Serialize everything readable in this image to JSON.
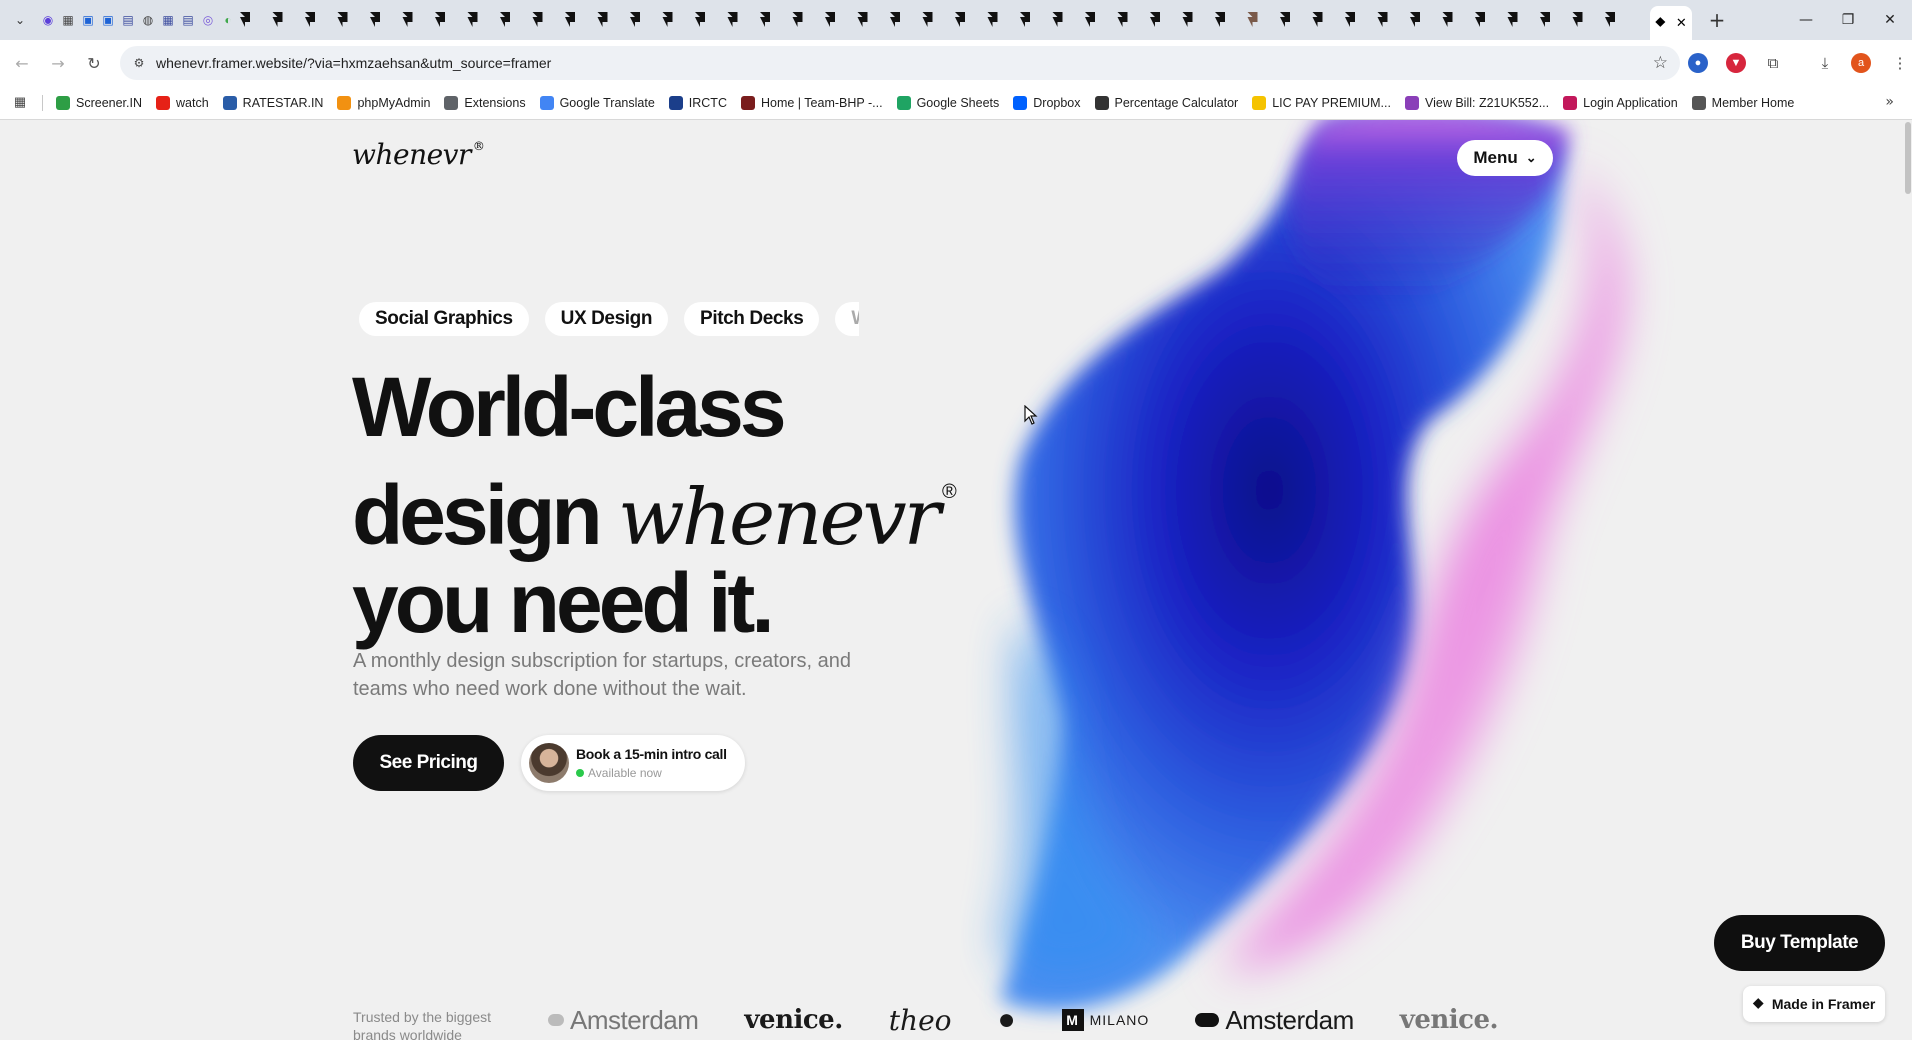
{
  "browser": {
    "tab": {
      "favicon": "framer-icon",
      "close_label": "✕"
    },
    "new_tab_label": "+",
    "window": {
      "minimize": "—",
      "restore": "❐",
      "close": "✕"
    },
    "nav": {
      "back": "←",
      "forward": "→",
      "reload": "↻"
    },
    "url": "whenevr.framer.website/?via=hxmzaehsan&utm_source=framer",
    "profile_initial": "a",
    "bookmarks": [
      {
        "label": "Screener.IN",
        "icon_color": "#2e9e45"
      },
      {
        "label": "watch",
        "icon_color": "#e62117"
      },
      {
        "label": "RATESTAR.IN",
        "icon_color": "#2a5da8"
      },
      {
        "label": "phpMyAdmin",
        "icon_color": "#f29111"
      },
      {
        "label": "Extensions",
        "icon_color": "#5f6368"
      },
      {
        "label": "Google Translate",
        "icon_color": "#4285f4"
      },
      {
        "label": "IRCTC",
        "icon_color": "#1b3e8a"
      },
      {
        "label": "Home | Team-BHP -...",
        "icon_color": "#7a1d1d"
      },
      {
        "label": "Google Sheets",
        "icon_color": "#1fa463"
      },
      {
        "label": "Dropbox",
        "icon_color": "#0061fe"
      },
      {
        "label": "Percentage Calculator",
        "icon_color": "#333333"
      },
      {
        "label": "LIC PAY PREMIUM...",
        "icon_color": "#f5c300"
      },
      {
        "label": "View Bill: Z21UK552...",
        "icon_color": "#8a3fb8"
      },
      {
        "label": "Login Application",
        "icon_color": "#c2185b"
      },
      {
        "label": "Member Home",
        "icon_color": "#555555"
      }
    ],
    "bookmarks_more": "»"
  },
  "site": {
    "logo": "whenevr",
    "logo_mark": "®",
    "menu_label": "Menu",
    "chips": [
      "Social Graphics",
      "UX Design",
      "Pitch Decks",
      "We"
    ],
    "headline": {
      "line1": "World-class",
      "line2_prefix": "design",
      "line2_brand": "whenevr",
      "line2_mark": "®",
      "line3": "you need it."
    },
    "subtitle": "A monthly design subscription for startups, creators, and teams who need work done without the wait.",
    "cta_pricing": "See Pricing",
    "cta_call": {
      "title": "Book a 15-min intro call",
      "status": "Available now"
    },
    "buy_template": "Buy Template",
    "made_in_framer": "Made in Framer",
    "trusted_text": "Trusted by the biggest brands worldwide",
    "brands": [
      "Amsterdam",
      "venice.",
      "theo",
      "",
      "MILANO",
      "Amsterdam",
      "venice."
    ]
  },
  "colors": {
    "page_bg": "#f0f0f0",
    "primary_button": "#111111",
    "available_dot": "#2ac94b",
    "blob_blue": "#1b1fb8",
    "blob_pink": "#e48ae0"
  }
}
